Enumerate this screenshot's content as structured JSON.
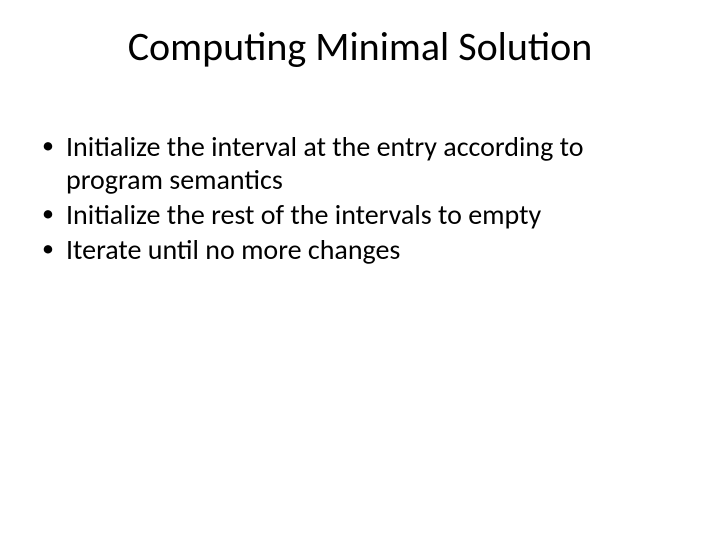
{
  "title": "Computing Minimal Solution",
  "bullets": [
    "Initialize the interval at the entry according to program semantics",
    "Initialize the rest of the intervals to empty",
    "Iterate until no more changes"
  ]
}
